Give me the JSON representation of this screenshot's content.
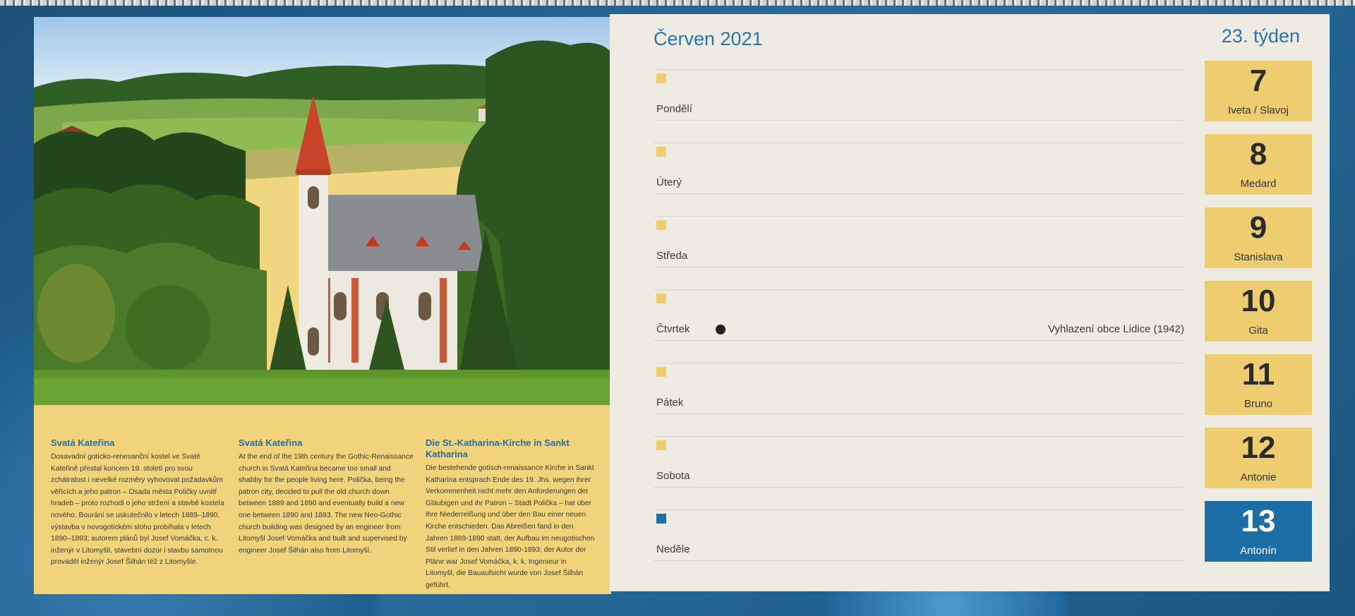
{
  "photo_captions": [
    {
      "heading": "Svatá Kateřina",
      "text": "Dosavadní goticko-renesanční kostel ve Svaté Kateřině přestal koncem 19. století pro svou zchátralost i nevelké rozměry vyhovovat požadavkům věřících a jeho patron – Osada města Poličky uvnitř hradeb – proto rozhodl o jeho stržení a stavbě kostela nového. Bourání se uskutečnilo v letech 1889–1890, výstavba v novogotickém slohu probíhala v letech 1890–1893; autorem plánů byl Josef Vomáčka, c. k. inženýr v Litomyšli, stavební dozor i stavbu samotnou prováděl inženýr Josef Šilhán též z Litomyšle."
    },
    {
      "heading": "Svatá Kateřina",
      "text": "At the end of the 19th century the Gothic-Renaissance church in Svatá Kateřina became too small and shabby for the people living here. Polička, being the patron city, decided to pull the old church down between 1889 and 1890 and eventually build a new one between 1890 and 1893. The new Neo-Gothic church building was designed by an engineer from Litomyšl Josef Vomáčka and built and supervised by engineer Josef Šilhán also from Litomyšl."
    },
    {
      "heading": "Die St.-Katharina-Kirche in Sankt Katharina",
      "text": "Die bestehende gotisch-renaissance Kirche in Sankt Katharina entsprach Ende des 19. Jhs. wegen ihrer Verkommenheit nicht mehr den Anforderungen der Gläubigen und ihr Patron – Stadt Polička – hat über ihre Niederreißung und über den Bau einer neuen Kirche entschieden. Das Abreißen fand in den Jahren 1889-1890 statt, der Aufbau im neugotischen Stil verlief in den Jahren 1890-1893; der Autor der Pläne war Josef Vomáčka, k. k. Ingenieur in Litomyšl, die Bauaufsicht wurde von Josef Šilhán geführt."
    }
  ],
  "planner": {
    "month": "Červen 2021",
    "week": "23. týden",
    "days": [
      {
        "day": "Pondělí",
        "date": "7",
        "nameday": "Iveta / Slavoj",
        "event": ""
      },
      {
        "day": "Úterý",
        "date": "8",
        "nameday": "Medard",
        "event": ""
      },
      {
        "day": "Středa",
        "date": "9",
        "nameday": "Stanislava",
        "event": ""
      },
      {
        "day": "Čtvrtek",
        "date": "10",
        "nameday": "Gita",
        "event": "Vyhlazení obce Lidice (1942)"
      },
      {
        "day": "Pátek",
        "date": "11",
        "nameday": "Bruno",
        "event": ""
      },
      {
        "day": "Sobota",
        "date": "12",
        "nameday": "Antonie",
        "event": ""
      },
      {
        "day": "Neděle",
        "date": "13",
        "nameday": "Antonín",
        "event": ""
      }
    ]
  },
  "colors": {
    "accent_blue": "#1e6ea6",
    "date_yellow": "#eecd70",
    "caption_bg": "#f1d37c"
  }
}
